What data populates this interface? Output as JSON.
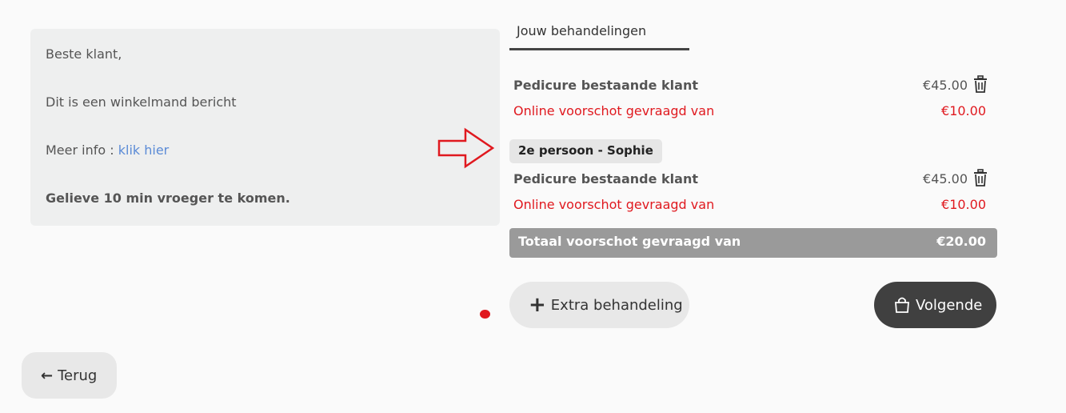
{
  "message": {
    "greeting": "Beste klant,",
    "body": "Dit is een winkelmand bericht",
    "more_info_label": "Meer info :",
    "more_info_link": "klik hier",
    "notice": "Gelieve 10 min vroeger te komen."
  },
  "tab": {
    "label": "Jouw behandelingen"
  },
  "treatments": [
    {
      "name": "Pedicure bestaande klant",
      "price": "€45.00",
      "deposit_label": "Online voorschot gevraagd van",
      "deposit_value": "€10.00"
    },
    {
      "name": "Pedicure bestaande klant",
      "price": "€45.00",
      "deposit_label": "Online voorschot gevraagd van",
      "deposit_value": "€10.00"
    }
  ],
  "person_badge": "2e persoon - Sophie",
  "total": {
    "label": "Totaal voorschot gevraagd van",
    "value": "€20.00"
  },
  "buttons": {
    "extra": "Extra behandeling",
    "next": "Volgende",
    "back": "Terug"
  },
  "colors": {
    "deposit_red": "#e0191f",
    "link_blue": "#5b8bd6",
    "total_bar": "#9a9a9a",
    "next_button": "#404040"
  },
  "icons": [
    "trash-icon",
    "plus-icon",
    "shopping-bag-icon",
    "arrow-left-icon",
    "arrow-right-outline-icon"
  ]
}
